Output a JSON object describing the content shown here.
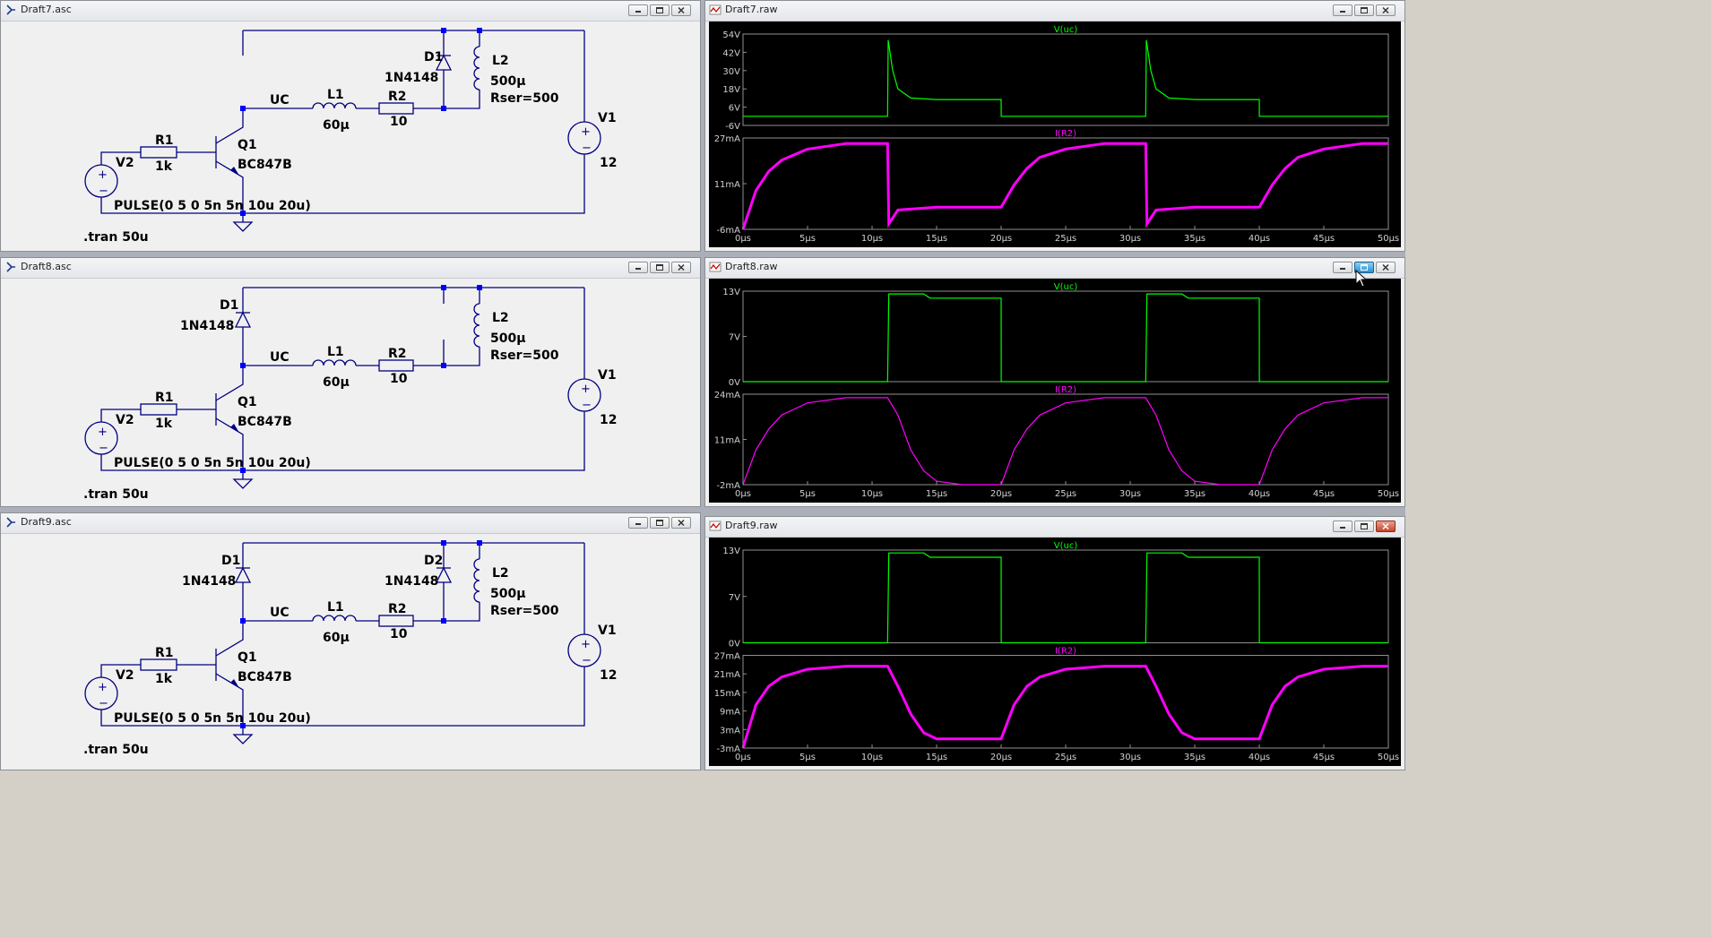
{
  "schematics": [
    {
      "title": "Draft7.asc",
      "labels": {
        "v2": "V2",
        "r1": "R1",
        "r1val": "1k",
        "q1": "Q1",
        "q1val": "BC847B",
        "uc": "UC",
        "l1": "L1",
        "l1val": "60µ",
        "r2": "R2",
        "r2val": "10",
        "d1": "D1",
        "d1val": "1N4148",
        "l2": "L2",
        "l2val": "500µ",
        "l2rser": "Rser=500",
        "v1": "V1",
        "v1val": "12",
        "pulse": "PULSE(0 5 0 5n 5n 10u 20u)",
        "tran": ".tran 50u"
      }
    },
    {
      "title": "Draft8.asc",
      "labels": {
        "v2": "V2",
        "r1": "R1",
        "r1val": "1k",
        "q1": "Q1",
        "q1val": "BC847B",
        "uc": "UC",
        "l1": "L1",
        "l1val": "60µ",
        "r2": "R2",
        "r2val": "10",
        "d1": "D1",
        "d1val": "1N4148",
        "l2": "L2",
        "l2val": "500µ",
        "l2rser": "Rser=500",
        "v1": "V1",
        "v1val": "12",
        "pulse": "PULSE(0 5 0 5n 5n 10u 20u)",
        "tran": ".tran 50u"
      }
    },
    {
      "title": "Draft9.asc",
      "labels": {
        "v2": "V2",
        "r1": "R1",
        "r1val": "1k",
        "q1": "Q1",
        "q1val": "BC847B",
        "uc": "UC",
        "l1": "L1",
        "l1val": "60µ",
        "r2": "R2",
        "r2val": "10",
        "d1": "D1",
        "d1val": "1N4148",
        "d2": "D2",
        "d2val": "1N4148",
        "l2": "L2",
        "l2val": "500µ",
        "l2rser": "Rser=500",
        "v1": "V1",
        "v1val": "12",
        "pulse": "PULSE(0 5 0 5n 5n 10u 20u)",
        "tran": ".tran 50u"
      }
    }
  ],
  "colors": {
    "voltage_trace": "#00ff00",
    "current_trace": "#ff00ff",
    "wire": "#000080",
    "node": "#0000ff",
    "plot_bg": "#000000"
  },
  "chart_data": [
    {
      "window": "Draft7.raw",
      "type": "line",
      "panes": [
        {
          "series": "V(uc)",
          "ylabels": [
            "54V",
            "42V",
            "30V",
            "18V",
            "6V",
            "-6V"
          ],
          "ylim": [
            -6,
            54
          ],
          "x": [
            0,
            10,
            11.2,
            11.25,
            11.6,
            12,
            13,
            15,
            20,
            20.01,
            30,
            31.2,
            31.25,
            31.6,
            32,
            33,
            35,
            40,
            40.01,
            50
          ],
          "y": [
            0,
            0,
            0,
            50,
            30,
            18,
            12,
            11,
            11,
            0,
            0,
            0,
            50,
            30,
            18,
            12,
            11,
            11,
            0,
            0
          ]
        },
        {
          "series": "I(R2)",
          "ylabels": [
            "27mA",
            "11mA",
            "-6mA"
          ],
          "ylim": [
            -6,
            27
          ],
          "x": [
            0,
            1,
            2,
            3,
            5,
            8,
            11.2,
            11.3,
            12,
            15,
            20,
            21,
            22,
            23,
            25,
            28,
            31.2,
            31.3,
            32,
            35,
            40,
            41,
            42,
            43,
            45,
            48,
            50
          ],
          "y": [
            -6,
            8,
            15,
            19,
            23,
            25,
            25,
            -4,
            1,
            2,
            2,
            10,
            16,
            20,
            23,
            25,
            25,
            -4,
            1,
            2,
            2,
            10,
            16,
            20,
            23,
            25,
            25
          ]
        }
      ],
      "xticks": [
        "0µs",
        "5µs",
        "10µs",
        "15µs",
        "20µs",
        "25µs",
        "30µs",
        "35µs",
        "40µs",
        "45µs",
        "50µs"
      ],
      "xlim": [
        0,
        50
      ]
    },
    {
      "window": "Draft8.raw",
      "type": "line",
      "panes": [
        {
          "series": "V(uc)",
          "ylabels": [
            "13V",
            "7V",
            "0V"
          ],
          "ylim": [
            0,
            13
          ],
          "x": [
            0,
            11.2,
            11.3,
            14,
            14.5,
            20,
            20.01,
            31.2,
            31.3,
            34,
            34.5,
            40,
            40.01,
            50
          ],
          "y": [
            0,
            0,
            12.6,
            12.6,
            12,
            12,
            0,
            0,
            12.6,
            12.6,
            12,
            12,
            0,
            0
          ]
        },
        {
          "series": "I(R2)",
          "ylabels": [
            "24mA",
            "11mA",
            "-2mA"
          ],
          "ylim": [
            -2,
            24
          ],
          "x": [
            0,
            1,
            2,
            3,
            5,
            8,
            11.2,
            12,
            13,
            14,
            15,
            17,
            20,
            21,
            22,
            23,
            25,
            28,
            31.2,
            32,
            33,
            34,
            35,
            37,
            40,
            41,
            42,
            43,
            45,
            48,
            50
          ],
          "y": [
            -2,
            8,
            14,
            18,
            21.5,
            23,
            23,
            18,
            8,
            2,
            -1,
            -2,
            -2,
            8,
            14,
            18,
            21.5,
            23,
            23,
            18,
            8,
            2,
            -1,
            -2,
            -2,
            8,
            14,
            18,
            21.5,
            23,
            23
          ]
        }
      ],
      "xticks": [
        "0µs",
        "5µs",
        "10µs",
        "15µs",
        "20µs",
        "25µs",
        "30µs",
        "35µs",
        "40µs",
        "45µs",
        "50µs"
      ],
      "xlim": [
        0,
        50
      ]
    },
    {
      "window": "Draft9.raw",
      "type": "line",
      "panes": [
        {
          "series": "V(uc)",
          "ylabels": [
            "13V",
            "7V",
            "0V"
          ],
          "ylim": [
            0,
            13
          ],
          "x": [
            0,
            11.2,
            11.3,
            14,
            14.5,
            20,
            20.01,
            31.2,
            31.3,
            34,
            34.5,
            40,
            40.01,
            50
          ],
          "y": [
            0,
            0,
            12.6,
            12.6,
            12,
            12,
            0,
            0,
            12.6,
            12.6,
            12,
            12,
            0,
            0
          ]
        },
        {
          "series": "I(R2)",
          "ylabels": [
            "27mA",
            "21mA",
            "15mA",
            "9mA",
            "3mA",
            "-3mA"
          ],
          "ylim": [
            -3,
            27
          ],
          "x": [
            0,
            1,
            2,
            3,
            5,
            8,
            11.2,
            12,
            13,
            14,
            15,
            17,
            20,
            21,
            22,
            23,
            25,
            28,
            31.2,
            32,
            33,
            34,
            35,
            37,
            40,
            41,
            42,
            43,
            45,
            48,
            50
          ],
          "y": [
            -3,
            11,
            17,
            20,
            22.5,
            23.5,
            23.5,
            17,
            8,
            2,
            0,
            0,
            0,
            11,
            17,
            20,
            22.5,
            23.5,
            23.5,
            17,
            8,
            2,
            0,
            0,
            0,
            11,
            17,
            20,
            22.5,
            23.5,
            23.5
          ]
        }
      ],
      "xticks": [
        "0µs",
        "5µs",
        "10µs",
        "15µs",
        "20µs",
        "25µs",
        "30µs",
        "35µs",
        "40µs",
        "45µs",
        "50µs"
      ],
      "xlim": [
        0,
        50
      ]
    }
  ]
}
